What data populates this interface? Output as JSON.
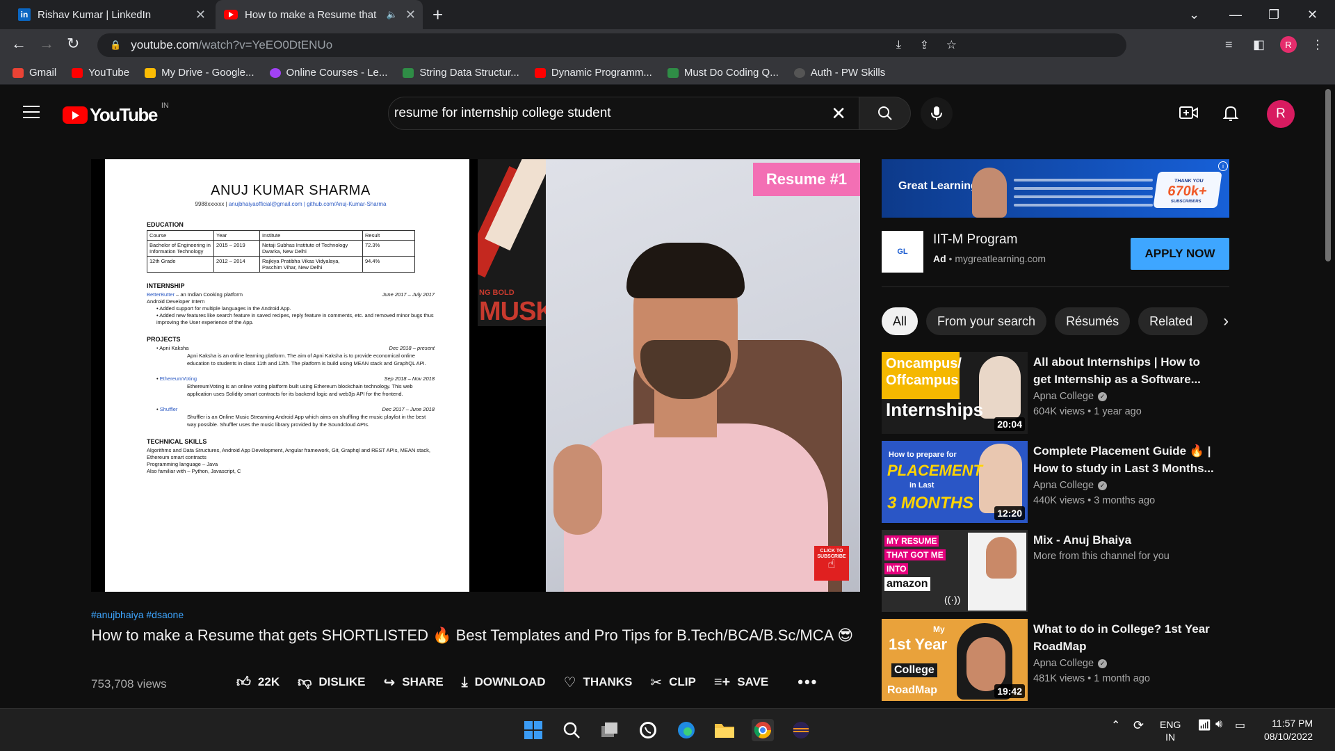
{
  "browser": {
    "tabs": [
      {
        "title": "Rishav Kumar | LinkedIn",
        "icon": "linkedin-icon",
        "active": false
      },
      {
        "title": "How to make a Resume that",
        "icon": "youtube-icon",
        "active": true
      }
    ],
    "url_host": "youtube.com",
    "url_path": "/watch?v=YeEO0DtENUo",
    "profile_initial": "R",
    "bookmarks": [
      {
        "label": "Gmail",
        "color": "#ea4335"
      },
      {
        "label": "YouTube",
        "color": "#ff0000"
      },
      {
        "label": "My Drive - Google...",
        "color": "#fbbc04"
      },
      {
        "label": "Online Courses - Le...",
        "color": "#a142f4"
      },
      {
        "label": "String Data Structur...",
        "color": "#2f8d46"
      },
      {
        "label": "Dynamic Programm...",
        "color": "#ff0000"
      },
      {
        "label": "Must Do Coding Q...",
        "color": "#2f8d46"
      },
      {
        "label": "Auth - PW Skills",
        "color": "#555555"
      }
    ]
  },
  "youtube": {
    "logo_text": "YouTube",
    "country_code": "IN",
    "search_query": "resume for internship college student",
    "avatar_initial": "R"
  },
  "video": {
    "overlay_badge": "Resume #1",
    "subscribe_text": "CLICK TO SUBSCRIBE",
    "poster_small": "NG BOLD",
    "poster_big": "MUSK",
    "hashtags": "#anujbhaiya #dsaone",
    "title": "How to make a Resume that gets SHORTLISTED 🔥 Best Templates and Pro Tips for B.Tech/BCA/B.Sc/MCA 😎",
    "views": "753,708 views",
    "actions": {
      "like": "22K",
      "dislike": "DISLIKE",
      "share": "SHARE",
      "download": "DOWNLOAD",
      "thanks": "THANKS",
      "clip": "CLIP",
      "save": "SAVE"
    },
    "resume": {
      "name": "ANUJ KUMAR SHARMA",
      "contact_phone": "9988xxxxxx | ",
      "contact_links": "anujbhaiyaofficial@gmail.com | github.com/Anuj-Kumar-Sharma",
      "education_heading": "EDUCATION",
      "edu_headers": [
        "Course",
        "Year",
        "Institute",
        "Result"
      ],
      "edu_rows": [
        [
          "Bachelor of Engineering in Information Technology",
          "2015 – 2019",
          "Netaji Subhas Institute of Technology Dwarka, New Delhi",
          "72.3%"
        ],
        [
          "12th Grade",
          "2012 – 2014",
          "Rajkiya Pratibha Vikas Vidyalaya, Paschim Vihar, New Delhi",
          "94.4%"
        ]
      ],
      "internship_heading": "INTERNSHIP",
      "internship_company": "BetterButter",
      "internship_company_desc": " – an Indian Cooking platform",
      "internship_dates": "June 2017 – July 2017",
      "internship_role": "Android Developer Intern",
      "internship_points": [
        "Added support for multiple languages in the Android App.",
        "Added new features like search feature in saved recipes, reply feature in comments, etc. and removed minor bugs thus improving the User experience of the App."
      ],
      "projects_heading": "PROJECTS",
      "projects": [
        {
          "name": "Apni Kaksha",
          "dates": "Dec 2018 – present",
          "link": false,
          "desc": "Apni Kaksha is an online learning platform. The aim of Apni Kaksha is to provide economical online education to students in class 11th and 12th. The platform is build using MEAN stack and GraphQL API."
        },
        {
          "name": "EthereumVoting",
          "dates": "Sep 2018 – Nov 2018",
          "link": true,
          "desc": "EthereumVoting is an online voting platform built using Ethereum blockchain technology. This web application uses Solidity smart contracts for its backend logic and web3js API for the frontend."
        },
        {
          "name": "Shuffler",
          "dates": "Dec 2017 – June 2018",
          "link": true,
          "desc": "Shuffler is an Online Music Streaming Android App which aims on shuffling the music playlist in the best way possible. Shuffler uses the music library provided by the Soundcloud APIs."
        }
      ],
      "skills_heading": "TECHNICAL SKILLS",
      "skills_lines": [
        "Algorithms and Data Structures, Android App Development, Angular framework, Git, Graphql and REST APIs, MEAN stack, Ethereum smart contracts",
        "Programming language – Java",
        "Also familiar with – Python, Javascript, C"
      ]
    }
  },
  "ad": {
    "brand": "Great Learning",
    "banner_count": "670k+",
    "banner_count_caption": "THANK YOU",
    "banner_count_sub": "SUBSCRIBERS",
    "title": "IIT-M Program",
    "label": "Ad",
    "domain": "mygreatlearning.com",
    "cta": "APPLY NOW"
  },
  "chips": [
    "All",
    "From your search",
    "Résumés",
    "Related"
  ],
  "recommendations": [
    {
      "title": "All about Internships | How to get Internship as a Software...",
      "channel": "Apna College",
      "verified": true,
      "meta": "604K views • 1 year ago",
      "duration": "20:04",
      "thumb_lines": [
        "Oncampus/",
        "Offcampus",
        "Internships"
      ],
      "thumb_bg": "#1c1c1c",
      "thumb_accent": "#f5b800"
    },
    {
      "title": "Complete Placement Guide 🔥 | How to study in Last 3 Months...",
      "channel": "Apna College",
      "verified": true,
      "meta": "440K views • 3 months ago",
      "duration": "12:20",
      "thumb_lines": [
        "How to prepare for",
        "PLACEMENT",
        "in Last",
        "3 MONTHS"
      ],
      "thumb_bg": "#2a56c6",
      "thumb_accent": "#ffd400"
    },
    {
      "title": "Mix - Anuj Bhaiya",
      "channel": "More from this channel for you",
      "verified": false,
      "meta": "",
      "duration": "",
      "thumb_lines": [
        "MY RESUME",
        "THAT GOT ME",
        "INTO",
        "amazon"
      ],
      "thumb_bg": "#2b2b2b",
      "thumb_accent": "#e6007e"
    },
    {
      "title": "What to do in College? 1st Year RoadMap",
      "channel": "Apna College",
      "verified": true,
      "meta": "481K views • 1 month ago",
      "duration": "19:42",
      "thumb_lines": [
        "My",
        "1st Year",
        "College",
        "RoadMap"
      ],
      "thumb_bg": "#e9a23b",
      "thumb_accent": "#ffffff"
    }
  ],
  "taskbar": {
    "lang_top": "ENG",
    "lang_bottom": "IN",
    "time": "11:57 PM",
    "date": "08/10/2022"
  }
}
